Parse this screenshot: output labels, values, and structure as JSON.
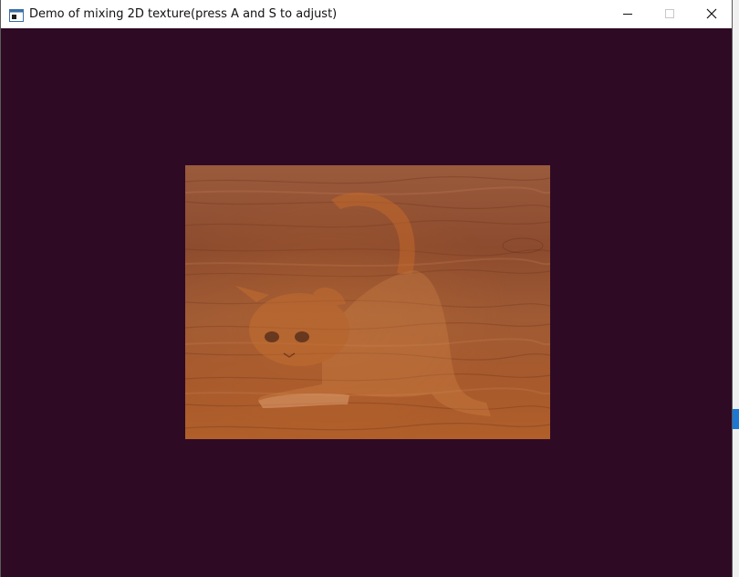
{
  "window": {
    "title": "Demo of mixing 2D texture(press A and S to adjust)",
    "clear_color": "#2e0a24"
  },
  "caption_buttons": {
    "minimize_icon": "minimize-icon",
    "maximize_icon": "maximize-icon",
    "close_icon": "close-icon"
  },
  "texture": {
    "base": "wood-texture",
    "overlay": "cat-texture"
  }
}
